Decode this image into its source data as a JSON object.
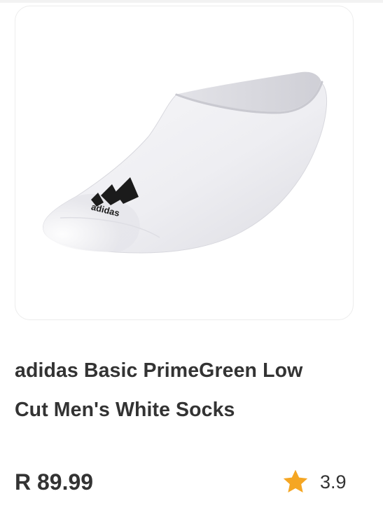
{
  "product": {
    "title_line1": "adidas Basic PrimeGreen Low",
    "title_line2": "Cut Men's White Socks",
    "price": "R 89.99",
    "rating": "3.9",
    "image_alt": "adidas low cut white sock",
    "logo_text": "adidas"
  },
  "icons": {
    "rating": "star-icon"
  },
  "colors": {
    "text": "#333333",
    "star": "#F5A623",
    "card_border": "#ECECEC"
  }
}
